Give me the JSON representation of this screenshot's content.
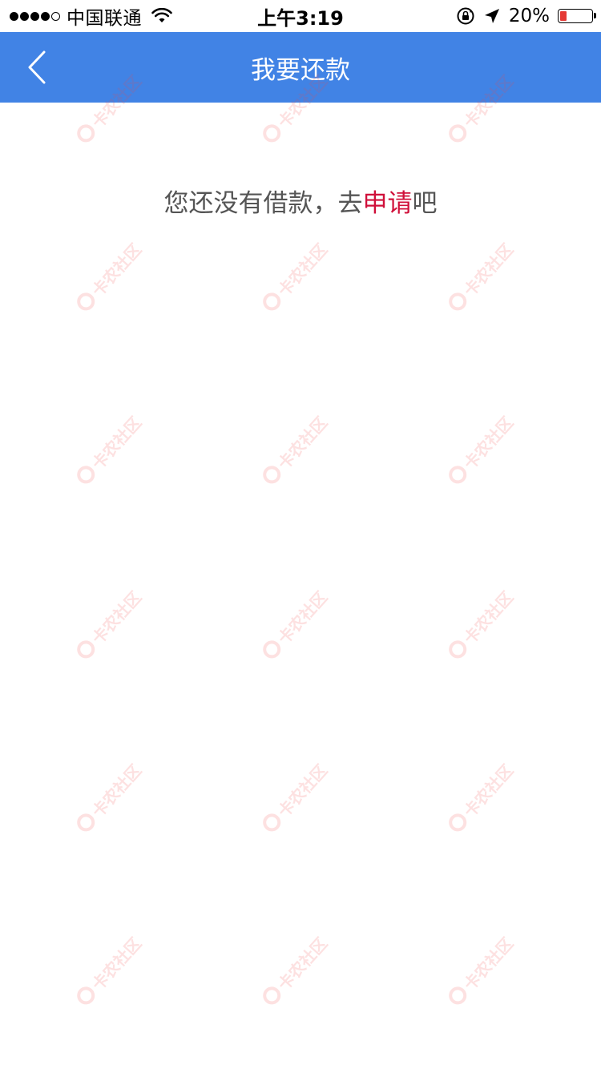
{
  "status_bar": {
    "carrier": "中国联通",
    "time": "上午3:19",
    "battery_percent": "20%",
    "battery_level": 0.2,
    "icons": [
      "signal-dots-icon",
      "wifi-icon",
      "rotation-lock-icon",
      "location-arrow-icon",
      "battery-icon"
    ]
  },
  "nav_bar": {
    "title": "我要还款",
    "back_icon": "chevron-left-icon",
    "background_color": "#4183e5"
  },
  "content": {
    "empty_prefix": "您还没有借款，去",
    "apply_link": "申请",
    "empty_suffix": "吧",
    "link_color": "#d0103a"
  },
  "watermark": {
    "text": "卡农社区"
  }
}
